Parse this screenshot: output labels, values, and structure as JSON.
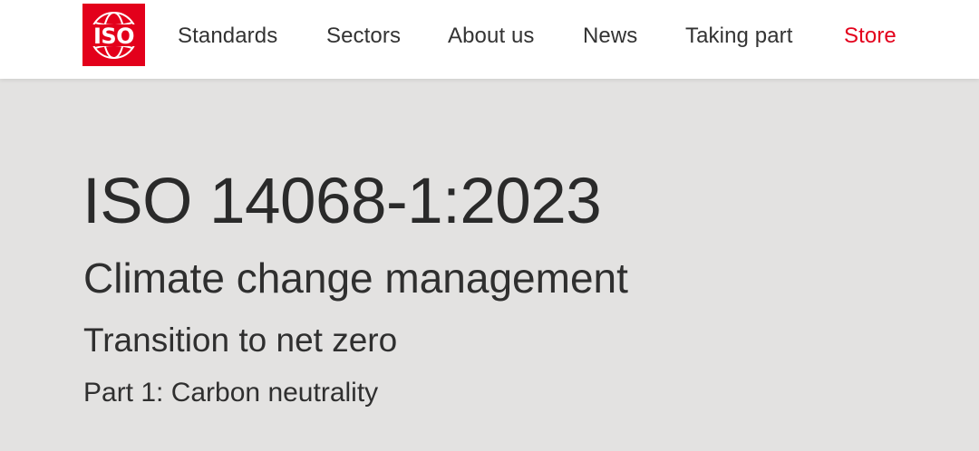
{
  "brand": {
    "logo_text": "ISO",
    "color": "#e3001b"
  },
  "nav": {
    "items": [
      {
        "label": "Standards"
      },
      {
        "label": "Sectors"
      },
      {
        "label": "About us"
      },
      {
        "label": "News"
      },
      {
        "label": "Taking part"
      },
      {
        "label": "Store",
        "color": "#e3001b"
      }
    ]
  },
  "standard": {
    "number": "ISO 14068-1:2023",
    "title": "Climate change management",
    "subtitle": "Transition to net zero",
    "part": "Part 1: Carbon neutrality"
  }
}
